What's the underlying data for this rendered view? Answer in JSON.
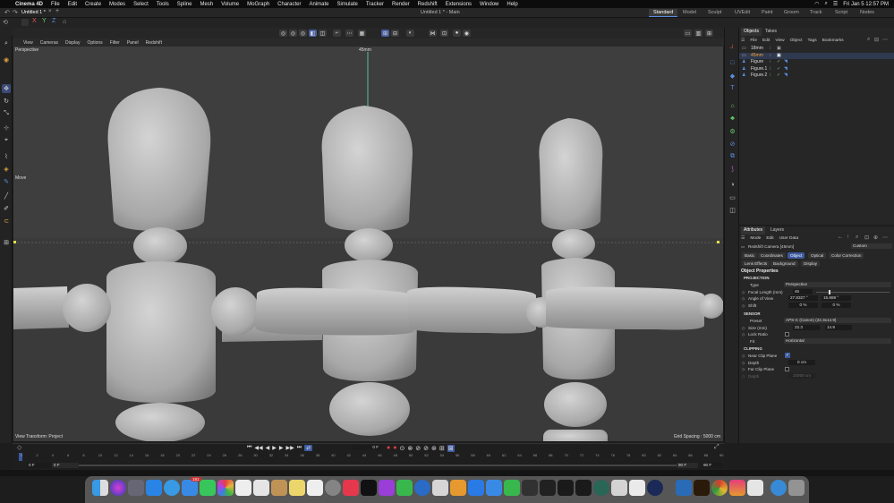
{
  "menubar": {
    "app": "Cinema 4D",
    "items": [
      "File",
      "Edit",
      "Create",
      "Modes",
      "Select",
      "Tools",
      "Spline",
      "Mesh",
      "Volume",
      "MoGraph",
      "Character",
      "Animate",
      "Simulate",
      "Tracker",
      "Render",
      "Redshift",
      "Extensions",
      "Window",
      "Help"
    ],
    "clock": "Fri Jan 5  12:57 PM"
  },
  "window": {
    "doc_tab": "Untitled 1 *",
    "title": "Untitled 1 * - Main",
    "layouts": [
      "Standard",
      "Model",
      "Sculpt",
      "UVEdit",
      "Paint",
      "Groom",
      "Track",
      "Script",
      "Nodes"
    ]
  },
  "viewport": {
    "menu": [
      "View",
      "Cameras",
      "Display",
      "Options",
      "Filter",
      "Panel",
      "Redshift"
    ],
    "label": "Perspective",
    "focal_label": "45mm",
    "tool_tip": "Move",
    "view_transform": "View Transform: Project",
    "grid_spacing": "Grid Spacing : 5000 cm"
  },
  "objects": {
    "tabs": [
      "Objects",
      "Takes"
    ],
    "menu": [
      "File",
      "Edit",
      "View",
      "Object",
      "Tags",
      "Bookmarks"
    ],
    "items": [
      {
        "name": "18mm",
        "color": "#d8d8d8"
      },
      {
        "name": "45mm",
        "color": "#f0a030"
      },
      {
        "name": "Figure",
        "color": "#d8d8d8"
      },
      {
        "name": "Figure.1",
        "color": "#d8d8d8"
      },
      {
        "name": "Figure.2",
        "color": "#d8d8d8"
      }
    ]
  },
  "attributes": {
    "tabs": [
      "Attributes",
      "Layers"
    ],
    "menu": [
      "Mode",
      "Edit",
      "User Data"
    ],
    "object_name": "Redshift Camera [45mm]",
    "preset_mode": "Custom",
    "section_tabs_1": [
      "Basic",
      "Coordinates",
      "Object",
      "Optical",
      "Color Correction"
    ],
    "section_tabs_2": [
      "Lens Effects",
      "Background",
      "Display"
    ],
    "header": "Object Properties",
    "projection": {
      "title": "PROJECTION",
      "type_label": "Type",
      "type_value": "Perspective",
      "focal_label": "Focal Length (mm)",
      "focal_value": "45",
      "angle_label": "Angle of View",
      "angle_h": "27.8327 °",
      "angle_v": "15.869 °",
      "shift_label": "Shift",
      "shift_x": "0 %",
      "shift_y": "0 %"
    },
    "sensor": {
      "title": "SENSOR",
      "preset_label": "Preset",
      "preset_value": "APS-C (Canon) (22.3x14.9)",
      "size_label": "Size (mm)",
      "size_w": "22.3",
      "size_h": "14.9",
      "lock_label": "Lock Ratio",
      "fit_label": "Fit",
      "fit_value": "Horizontal"
    },
    "clipping": {
      "title": "CLIPPING",
      "near_label": "Near Clip Plane",
      "depth_label": "Depth",
      "depth_value": "0 cm",
      "far_label": "Far Clip Plane",
      "far_depth_label": "Depth",
      "far_depth_value": "10000 cm"
    }
  },
  "timeline": {
    "ticks": [
      "0",
      "2",
      "4",
      "6",
      "8",
      "10",
      "12",
      "14",
      "16",
      "18",
      "20",
      "22",
      "24",
      "26",
      "28",
      "30",
      "32",
      "34",
      "36",
      "38",
      "40",
      "42",
      "44",
      "46",
      "48",
      "50",
      "52",
      "54",
      "56",
      "58",
      "60",
      "62",
      "64",
      "66",
      "68",
      "70",
      "72",
      "74",
      "76",
      "78",
      "80",
      "82",
      "84",
      "86",
      "88",
      "90"
    ],
    "current_frame": "0 F",
    "start": "0 F",
    "start2": "0 F",
    "end": "90 F",
    "end2": "90 F"
  },
  "dock": {
    "badge": "181"
  }
}
